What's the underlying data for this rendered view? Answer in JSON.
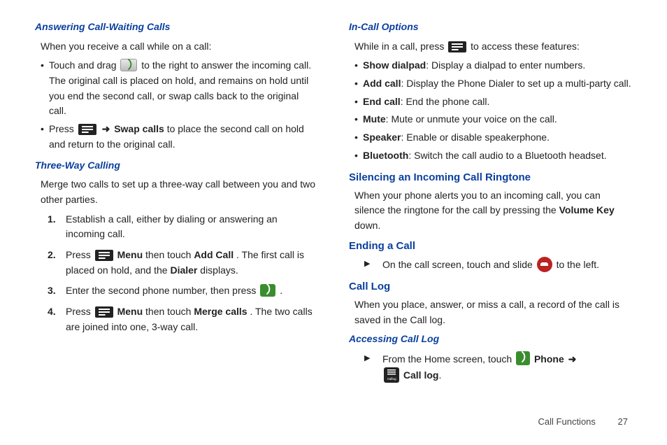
{
  "left": {
    "h1": "Answering Call-Waiting Calls",
    "p1": "When you receive a call while on a call:",
    "b1_a": "Touch and drag ",
    "b1_b": " to the right to answer the incoming call. The original call is placed on hold, and remains on hold until you end the second call, or swap calls back to the original call.",
    "b2_a": "Press ",
    "b2_b": "Swap calls",
    "b2_c": " to place the second call on hold and return to the original call.",
    "h2": "Three-Way Calling",
    "p2": "Merge two calls to set up a three-way call between you and two other parties.",
    "s1": "Establish a call, either by dialing or answering an incoming call.",
    "s2_a": "Press ",
    "s2_menu": "Menu",
    "s2_b": " then touch ",
    "s2_add": "Add Call",
    "s2_c": ". The first call is placed on hold, and the ",
    "s2_dialer": "Dialer",
    "s2_d": " displays.",
    "s3_a": "Enter the second phone number, then press ",
    "s3_b": ".",
    "s4_a": "Press ",
    "s4_menu": "Menu",
    "s4_b": " then touch ",
    "s4_merge": "Merge calls",
    "s4_c": ". The two calls are joined into one, 3-way call.",
    "num1": "1.",
    "num2": "2.",
    "num3": "3.",
    "num4": "4."
  },
  "right": {
    "h1": "In-Call Options",
    "p1_a": "While in a call, press ",
    "p1_b": " to access these features:",
    "opt1_l": "Show dialpad",
    "opt1_t": ": Display a dialpad to enter numbers.",
    "opt2_l": "Add call",
    "opt2_t": ": Display the Phone Dialer to set up a multi-party call.",
    "opt3_l": "End call",
    "opt3_t": ": End the phone call.",
    "opt4_l": "Mute",
    "opt4_t": ": Mute or unmute your voice on the call.",
    "opt5_l": "Speaker",
    "opt5_t": ": Enable or disable speakerphone.",
    "opt6_l": "Bluetooth",
    "opt6_t": ": Switch the call audio to a Bluetooth headset.",
    "h2": "Silencing an Incoming Call Ringtone",
    "p2_a": "When your phone alerts you to an incoming call, you can silence the ringtone for the call by pressing the ",
    "p2_vol": "Volume Key",
    "p2_b": " down.",
    "h3": "Ending a Call",
    "end_a": "On the call screen, touch and slide ",
    "end_b": " to the left.",
    "h4": "Call Log",
    "p4": "When you place, answer, or miss a call, a record of the call is saved in the Call log.",
    "h5": "Accessing Call Log",
    "acc_a": "From the Home screen, touch ",
    "acc_phone": "Phone",
    "acc_calllog": "Call log",
    "acc_dot": ".",
    "nav_arrow": "➜"
  },
  "footer": {
    "section": "Call Functions",
    "page": "27"
  }
}
